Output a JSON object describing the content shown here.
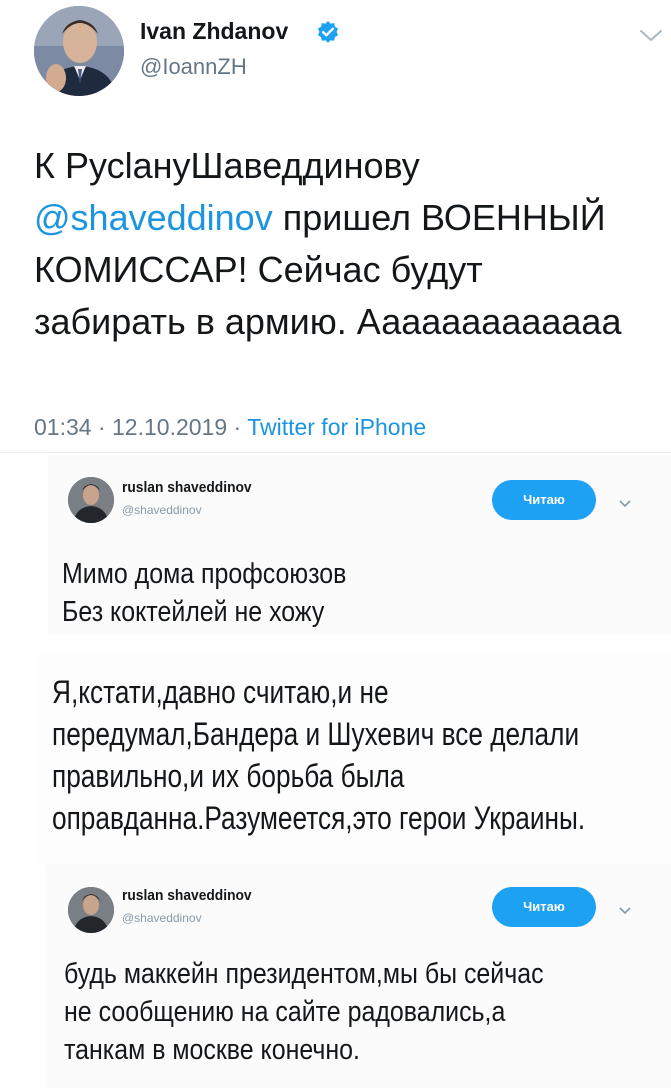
{
  "tweet": {
    "author_name": "Ivan Zhdanov",
    "author_handle": "@IoannZH",
    "text_line1": "К РусlануШаведдинову",
    "mention": "@shaveddinov",
    "text_line2_rest": " пришел ВОЕННЫЙ",
    "text_line3": "КОМИССАР! Сейчас будут",
    "text_line4": "забирать в армию. Ааааааааааааа",
    "time": "01:34",
    "date": "12.10.2019",
    "source": "Twitter for iPhone",
    "dot": "·"
  },
  "embed1": {
    "name": "ruslan shaveddinov",
    "handle": "@shaveddinov",
    "follow_label": "Читаю",
    "line1": "Мимо дома профсоюзов",
    "line2": "Без коктейлей не хожу"
  },
  "middle": {
    "line1": "Я,кстати,давно считаю,и не",
    "line2": "передумал,Бандера и Шухевич все делали",
    "line3": "правильно,и их борьба была",
    "line4": "оправданна.Разумеется,это герои Украины."
  },
  "embed2": {
    "name": "ruslan shaveddinov",
    "handle": "@shaveddinov",
    "follow_label": "Читаю",
    "line1": "будь маккейн президентом,мы бы сейчас",
    "line2": "не сообщению на сайте радовались,а",
    "line3": "танкам в москве конечно."
  },
  "icons": {
    "verified": "verified-badge-icon",
    "caret": "chevron-down-icon"
  },
  "colors": {
    "accent": "#1b95e0",
    "button": "#1da1f2",
    "muted": "#657786"
  }
}
